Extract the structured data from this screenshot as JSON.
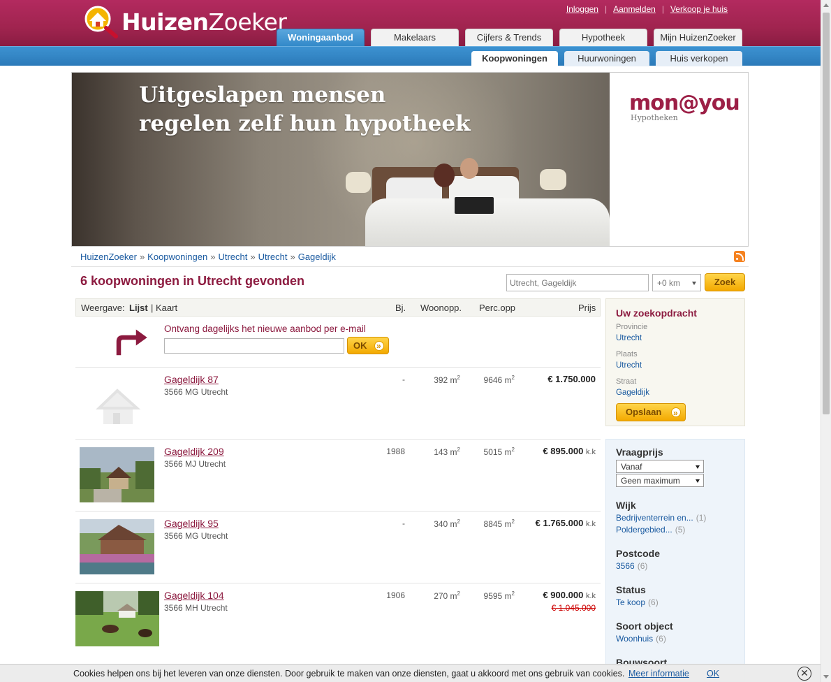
{
  "header": {
    "logo_bold": "Huizen",
    "logo_light": "Zoeker",
    "top_links": [
      "Inloggen",
      "Aanmelden",
      "Verkoop je huis"
    ],
    "tabs": [
      "Woningaanbod",
      "Makelaars",
      "Cijfers & Trends",
      "Hypotheek",
      "Mijn HuizenZoeker"
    ],
    "active_tab": "Woningaanbod",
    "subtabs": [
      "Koopwoningen",
      "Huurwoningen",
      "Huis verkopen"
    ],
    "active_subtab": "Koopwoningen"
  },
  "banner": {
    "headline_line1": "Uitgeslapen mensen",
    "headline_line2": "regelen zelf hun hypotheek",
    "brand": "mon@you",
    "brand_sub": "Hypotheken"
  },
  "breadcrumb": [
    "HuizenZoeker",
    "Koopwoningen",
    "Utrecht",
    "Utrecht",
    "Gageldijk"
  ],
  "results": {
    "title": "6 koopwoningen in Utrecht gevonden",
    "search_value": "Utrecht, Gageldijk",
    "radius": "+0 km",
    "search_button": "Zoek"
  },
  "list_header": {
    "view_label": "Weergave:",
    "view_list": "Lijst",
    "view_sep": "|",
    "view_map": "Kaart",
    "col_year": "Bj.",
    "col_area": "Woonopp.",
    "col_plot": "Perc.opp",
    "col_price": "Prijs"
  },
  "email_alert": {
    "title": "Ontvang dagelijks het nieuwe aanbod per e-mail",
    "button": "OK"
  },
  "listings": [
    {
      "street": "Gageldijk 87",
      "city": "3566 MG Utrecht",
      "year": "-",
      "area": "392 m",
      "plot": "9646 m",
      "price": "€ 1.750.000",
      "kk": "",
      "old_price": ""
    },
    {
      "street": "Gageldijk 209",
      "city": "3566 MJ Utrecht",
      "year": "1988",
      "area": "143 m",
      "plot": "5015 m",
      "price": "€ 895.000",
      "kk": "k.k",
      "old_price": ""
    },
    {
      "street": "Gageldijk 95",
      "city": "3566 MG Utrecht",
      "year": "-",
      "area": "340 m",
      "plot": "8845 m",
      "price": "€ 1.765.000",
      "kk": "k.k",
      "old_price": ""
    },
    {
      "street": "Gageldijk 104",
      "city": "3566 MH Utrecht",
      "year": "1906",
      "area": "270 m",
      "plot": "9595 m",
      "price": "€ 900.000",
      "kk": "k.k",
      "old_price": "€ 1.045.000"
    }
  ],
  "search_box": {
    "title": "Uw zoekopdracht",
    "province_label": "Provincie",
    "province": "Utrecht",
    "place_label": "Plaats",
    "place": "Utrecht",
    "street_label": "Straat",
    "street": "Gageldijk",
    "save_button": "Opslaan"
  },
  "filters": {
    "price_title": "Vraagprijs",
    "price_from": "Vanaf",
    "price_to": "Geen maximum",
    "wijk_title": "Wijk",
    "wijk_items": [
      {
        "label": "Bedrijventerrein en...",
        "count": "(1)"
      },
      {
        "label": "Poldergebied...",
        "count": "(5)"
      }
    ],
    "postcode_title": "Postcode",
    "postcode_items": [
      {
        "label": "3566",
        "count": "(6)"
      }
    ],
    "status_title": "Status",
    "status_items": [
      {
        "label": "Te koop",
        "count": "(6)"
      }
    ],
    "type_title": "Soort object",
    "type_items": [
      {
        "label": "Woonhuis",
        "count": "(6)"
      }
    ],
    "build_title": "Bouwsoort"
  },
  "cookie": {
    "message": "Cookies helpen ons bij het leveren van onze diensten. Door gebruik te maken van onze diensten, gaat u akkoord met ons gebruik van cookies.",
    "more": "Meer informatie",
    "ok": "OK",
    "close": "✕"
  },
  "colors": {
    "brand": "#a0244f",
    "nav_blue": "#3289c9",
    "accent": "#f3a900",
    "link": "#1a5aa0"
  }
}
